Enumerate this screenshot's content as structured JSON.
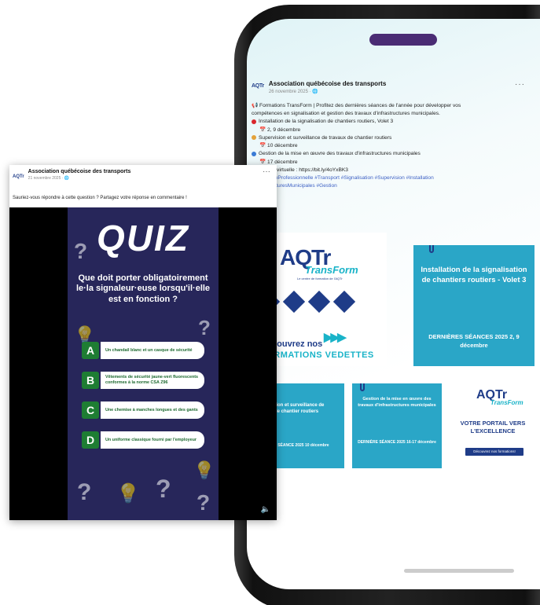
{
  "phone_post": {
    "logo": "AQTr",
    "org_name": "Association québécoise des transports",
    "date": "26 novembre 2025 · 🌐",
    "more": "···",
    "intro_line1": "📢 Formations TransForm | Profitez des dernières séances de l'année pour développer vos",
    "intro_line2": "compétences en signalisation et gestion des travaux d'infrastructures municipales.",
    "item1": "Installation de la signalisation de chantiers routiers, Volet 3",
    "item1_date": "📅 2, 9 décembre",
    "item2": "Supervision et surveillance de travaux de chantier routiers",
    "item2_date": "📅 10 décembre",
    "item3": "Gestion de la mise en œuvre des travaux d'infrastructures municipales",
    "item3_date": "📅 17 décembre",
    "link_line": "💻 Classe virtuelle : https://bit.ly/4oYxBK3",
    "hashtags1": "#FormationProfessionnelle #Transport #Signalisation #Supervision #Installation",
    "hashtags2": "#InfrastructuresMunicipales #Gestion"
  },
  "tiles": {
    "t1_logo": "AQTr",
    "t1_transform": "TransForm",
    "t1_center": "Le centre de formation de l'AQTr",
    "t1_line1": "Découvrez nos",
    "t1_line2": "FORMATIONS VEDETTES",
    "t2_title": "Installation de la signalisation de chantiers routiers - Volet 3",
    "t2_dates": "DERNIÈRES SÉANCES 2025 2, 9 décembre",
    "t3_title": "Supervision et surveillance de travaux de chantier routiers",
    "t3_dates": "DERNIÈRE SÉANCE 2025 10 décembre",
    "t4_title": "Gestion de la mise en œuvre des travaux d'infrastructures municipales",
    "t4_dates": "DERNIÈRE SÉANCE 2025 16-17 décembre",
    "t5_logo": "AQTr",
    "t5_transform": "TransForm",
    "t5_portal": "VOTRE PORTAIL VERS L'EXCELLENCE",
    "t5_button": "Découvrez nos formations!"
  },
  "fb_card": {
    "logo": "AQTr",
    "org_name": "Association québécoise des transports",
    "date": "21 novembre 2025 · 🌐",
    "more": "···",
    "caption": "Sauriez-vous répondre à cette question ? Partagez votre réponse en commentaire !",
    "quiz_title": "QUIZ",
    "question": "Que doit porter obligatoirement le·la signaleur·euse lorsqu'il·elle est en fonction ?",
    "answers": [
      {
        "letter": "A",
        "text": "Un chandail blanc et un casque de sécurité"
      },
      {
        "letter": "B",
        "text": "Vêtements de sécurité jaune-vert fluorescents conformes à la norme CSA Z96"
      },
      {
        "letter": "C",
        "text": "Une chemise à manches longues et des gants"
      },
      {
        "letter": "D",
        "text": "Un uniforme classique fourni par l'employeur"
      }
    ],
    "speaker_icon": "speaker-icon"
  },
  "colors": {
    "brand_navy": "#1f3c88",
    "brand_teal": "#19b3c8",
    "tile_teal": "#2aa6c7",
    "quiz_bg": "#27265a",
    "answer_green": "#1e7d33",
    "notch": "#4a2c74"
  }
}
